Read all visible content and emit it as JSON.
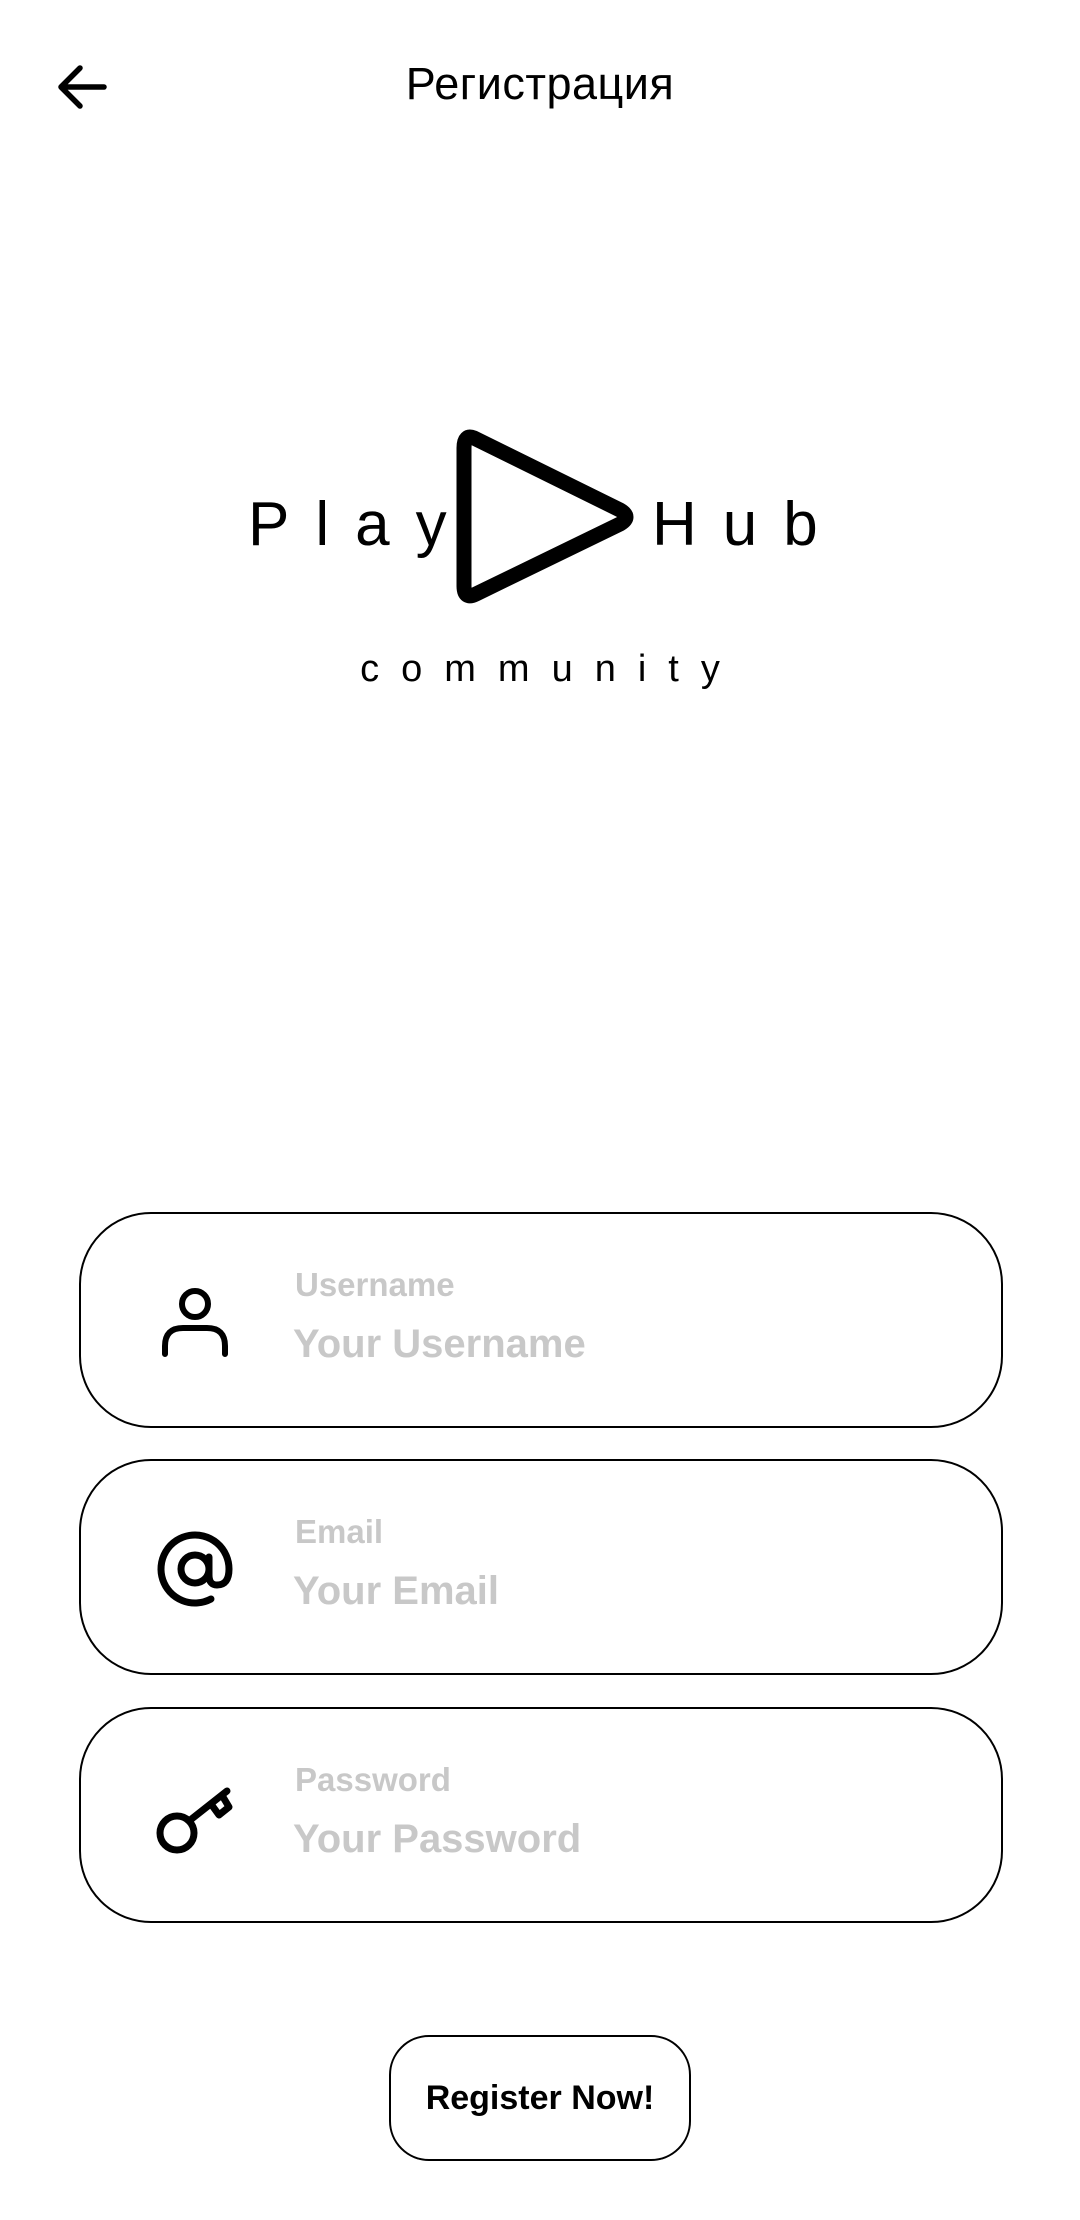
{
  "header": {
    "title": "Регистрация",
    "back_icon": "arrow-left-icon"
  },
  "logo": {
    "word_left": "Play",
    "word_right": "Hub",
    "subtitle": "community",
    "mark_icon": "play-triangle-icon"
  },
  "form": {
    "username": {
      "label": "Username",
      "placeholder": "Your Username",
      "value": "",
      "icon": "user-icon"
    },
    "email": {
      "label": "Email",
      "placeholder": "Your Email",
      "value": "",
      "icon": "at-sign-icon"
    },
    "password": {
      "label": "Password",
      "placeholder": "Your Password",
      "value": "",
      "icon": "key-icon"
    }
  },
  "actions": {
    "register_label": "Register Now!"
  }
}
